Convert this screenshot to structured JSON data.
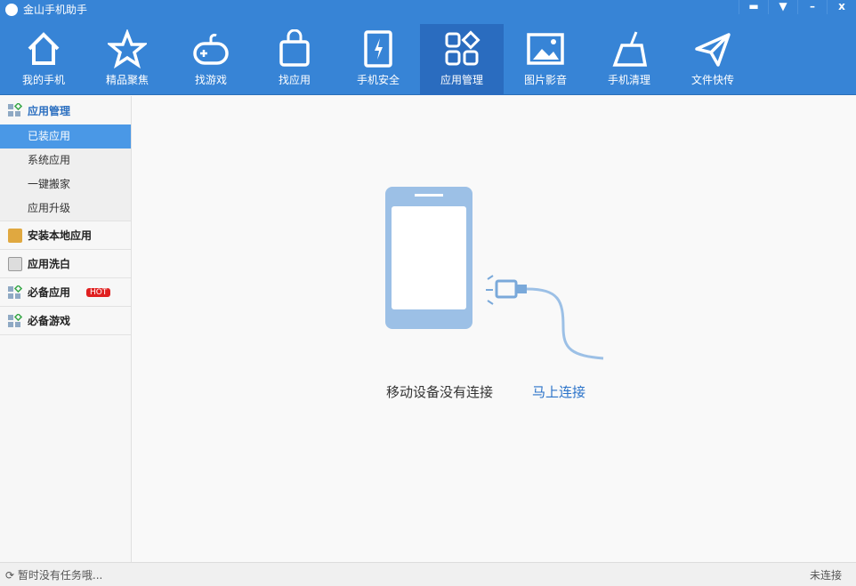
{
  "app": {
    "title": "金山手机助手"
  },
  "window_controls": [
    "message",
    "menu",
    "minimize",
    "close"
  ],
  "nav": [
    {
      "label": "我的手机",
      "icon": "home-icon"
    },
    {
      "label": "精品聚焦",
      "icon": "star-icon"
    },
    {
      "label": "找游戏",
      "icon": "gamepad-icon"
    },
    {
      "label": "找应用",
      "icon": "bag-icon"
    },
    {
      "label": "手机安全",
      "icon": "shield-phone-icon"
    },
    {
      "label": "应用管理",
      "icon": "apps-grid-icon",
      "active": true
    },
    {
      "label": "图片影音",
      "icon": "picture-icon"
    },
    {
      "label": "手机清理",
      "icon": "broom-icon"
    },
    {
      "label": "文件快传",
      "icon": "paper-plane-icon"
    }
  ],
  "sidebar": {
    "group_main": "应用管理",
    "subs": [
      "已装应用",
      "系统应用",
      "一键搬家",
      "应用升级"
    ],
    "groups": [
      {
        "label": "安装本地应用"
      },
      {
        "label": "应用洗白"
      },
      {
        "label": "必备应用",
        "badge": "HOT"
      },
      {
        "label": "必备游戏"
      }
    ]
  },
  "main": {
    "message": "移动设备没有连接",
    "connect_link": "马上连接"
  },
  "status": {
    "left": "暂时没有任务哦...",
    "right": "未连接"
  }
}
